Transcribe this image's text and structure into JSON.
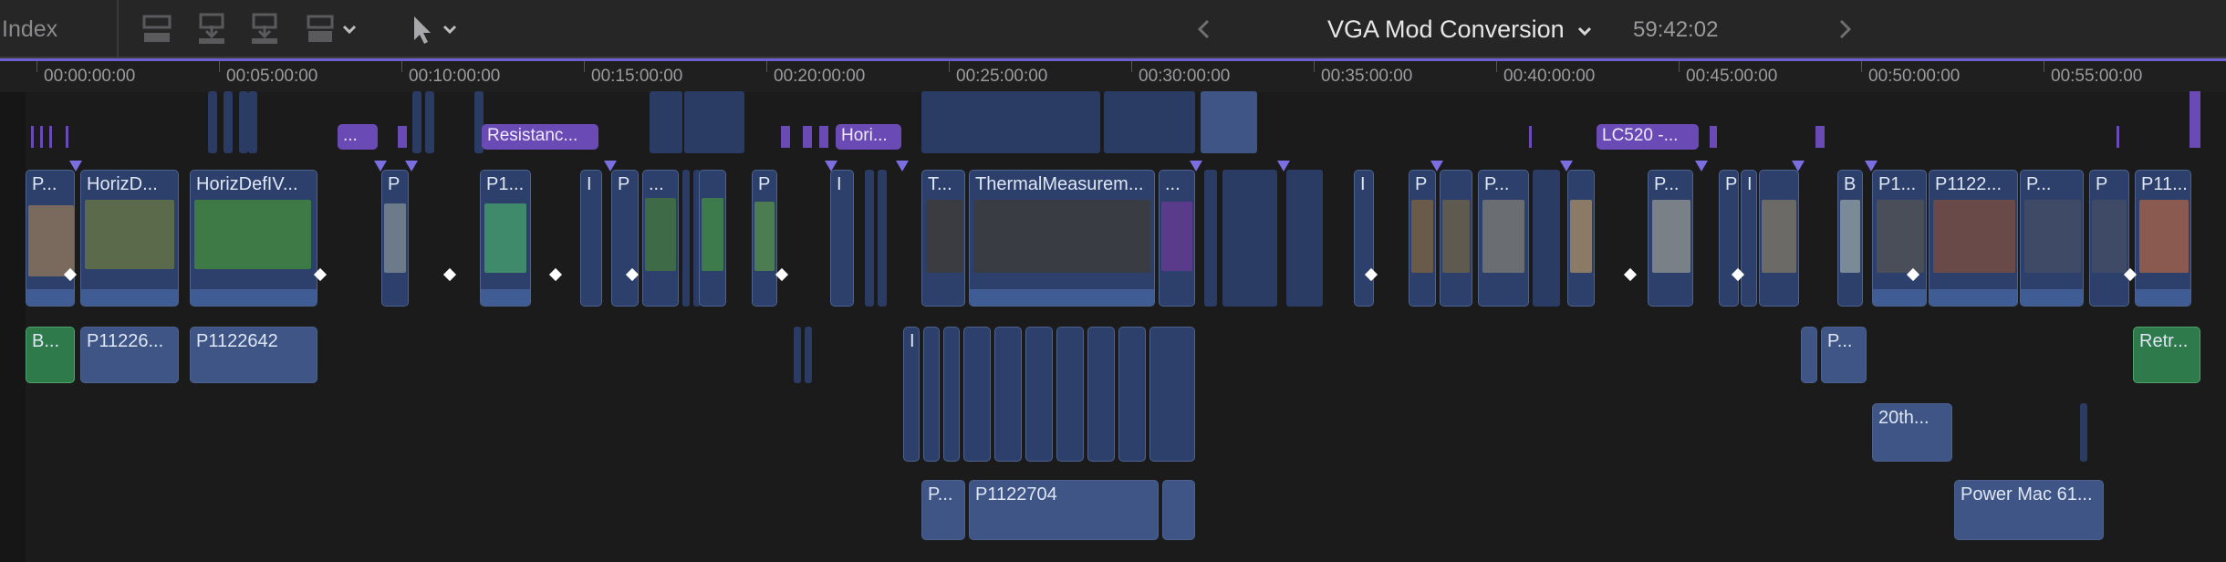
{
  "toolbar": {
    "index_label": "Index",
    "project_title": "VGA Mod Conversion",
    "duration": "59:42:02",
    "icons": [
      "lift-clip-icon",
      "append-below-icon",
      "insert-below-icon",
      "overwrite-icon",
      "dropdown-chevron-icon",
      "select-tool-icon",
      "tool-chevron-icon",
      "previous-arrow-icon",
      "project-menu-chevron-icon",
      "next-arrow-icon"
    ]
  },
  "ruler": {
    "labels": [
      "00:00:00:00",
      "00:05:00:00",
      "00:10:00:00",
      "00:15:00:00",
      "00:20:00:00",
      "00:25:00:00",
      "00:30:00:00",
      "00:35:00:00",
      "00:40:00:00",
      "00:45:00:00",
      "00:50:00:00",
      "00:55:00:00"
    ]
  },
  "title_clips": {
    "c1": "...",
    "c2": "Resistanc...",
    "c3": "Hori...",
    "c4": "LC520 -..."
  },
  "primary_clips": {
    "p1": "P...",
    "p2": "HorizD...",
    "p3": "HorizDefIV...",
    "p4": "P",
    "p5": "P1...",
    "p6": "I",
    "p7": "P",
    "p8": "...",
    "p9": "P",
    "p10": "I",
    "p11": "T...",
    "p12": "ThermalMeasurem...",
    "p13": "...",
    "p14": "I",
    "p15": "P",
    "p16": "P...",
    "p17": "P...",
    "p18": "P",
    "p19": "I",
    "p20": "B",
    "p21": "P1...",
    "p22": "P1122...",
    "p23": "P...",
    "p24": "P",
    "p25": "P11..."
  },
  "lower_clips": {
    "g1": "B...",
    "l1": "P11226...",
    "l2": "P1122642",
    "l3": "I",
    "l4": "P...",
    "g2": "Retr...",
    "l5": "20th...",
    "l6": "P...",
    "l7": "P1122704",
    "l8": "Power Mac 61..."
  }
}
